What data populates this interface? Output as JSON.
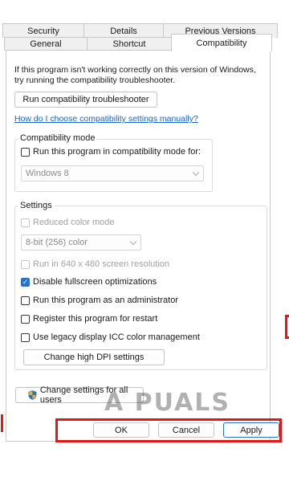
{
  "tabs_row1": [
    "Security",
    "Details",
    "Previous Versions"
  ],
  "tabs_row2": [
    "General",
    "Shortcut",
    "Compatibility"
  ],
  "intro_line1": "If this program isn't working correctly on this version of Windows,",
  "intro_line2": "try running the compatibility troubleshooter.",
  "troubleshooter_button": "Run compatibility troubleshooter",
  "manual_link": "How do I choose compatibility settings manually?",
  "compat_mode": {
    "legend": "Compatibility mode",
    "checkbox_label": "Run this program in compatibility mode for:",
    "checked": false,
    "select_value": "Windows 8"
  },
  "settings": {
    "legend": "Settings",
    "reduced_color": {
      "label": "Reduced color mode",
      "checked": false,
      "disabled": true
    },
    "color_select_value": "8-bit (256) color",
    "resolution_640": {
      "label": "Run in 640 x 480 screen resolution",
      "checked": false,
      "disabled": true
    },
    "disable_fullscreen": {
      "label": "Disable fullscreen optimizations",
      "checked": true
    },
    "run_admin": {
      "label": "Run this program as an administrator",
      "checked": false
    },
    "register_restart": {
      "label": "Register this program for restart",
      "checked": false
    },
    "legacy_icc": {
      "label": "Use legacy display ICC color management",
      "checked": false
    },
    "dpi_button": "Change high DPI settings"
  },
  "all_users_button": "Change settings for all users",
  "footer": {
    "ok": "OK",
    "cancel": "Cancel",
    "apply": "Apply"
  },
  "watermark": "A PUALS",
  "colors": {
    "accent": "#2b6fce",
    "highlight": "#e01818"
  }
}
